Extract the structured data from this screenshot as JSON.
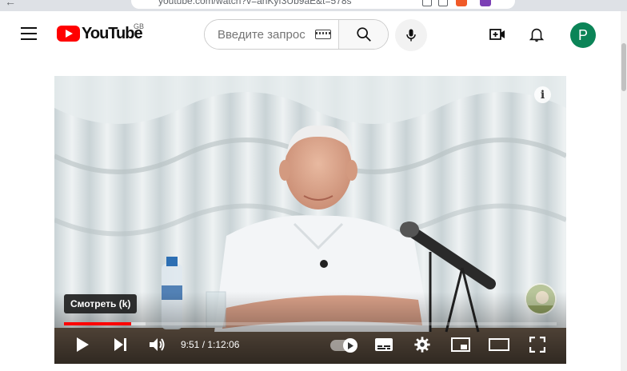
{
  "browser": {
    "url": "youtube.com/watch?v=anKyf3Ub9aE&t=578s"
  },
  "header": {
    "logo_text": "YouTube",
    "region_code": "GB",
    "search_placeholder": "Введите запрос",
    "avatar_letter": "P",
    "avatar_color": "#0b8457"
  },
  "player": {
    "tooltip": "Смотреть (k)",
    "time_display": "9:51 / 1:12:06",
    "progress_played": 0.137,
    "progress_loaded": 0.165,
    "played_color": "#ff0000",
    "autoplay_on": true,
    "icons": [
      "info-icon",
      "play-icon",
      "next-icon",
      "volume-icon",
      "autoplay-toggle",
      "subtitles-icon",
      "settings-icon",
      "miniplayer-icon",
      "theater-icon",
      "fullscreen-icon"
    ]
  }
}
